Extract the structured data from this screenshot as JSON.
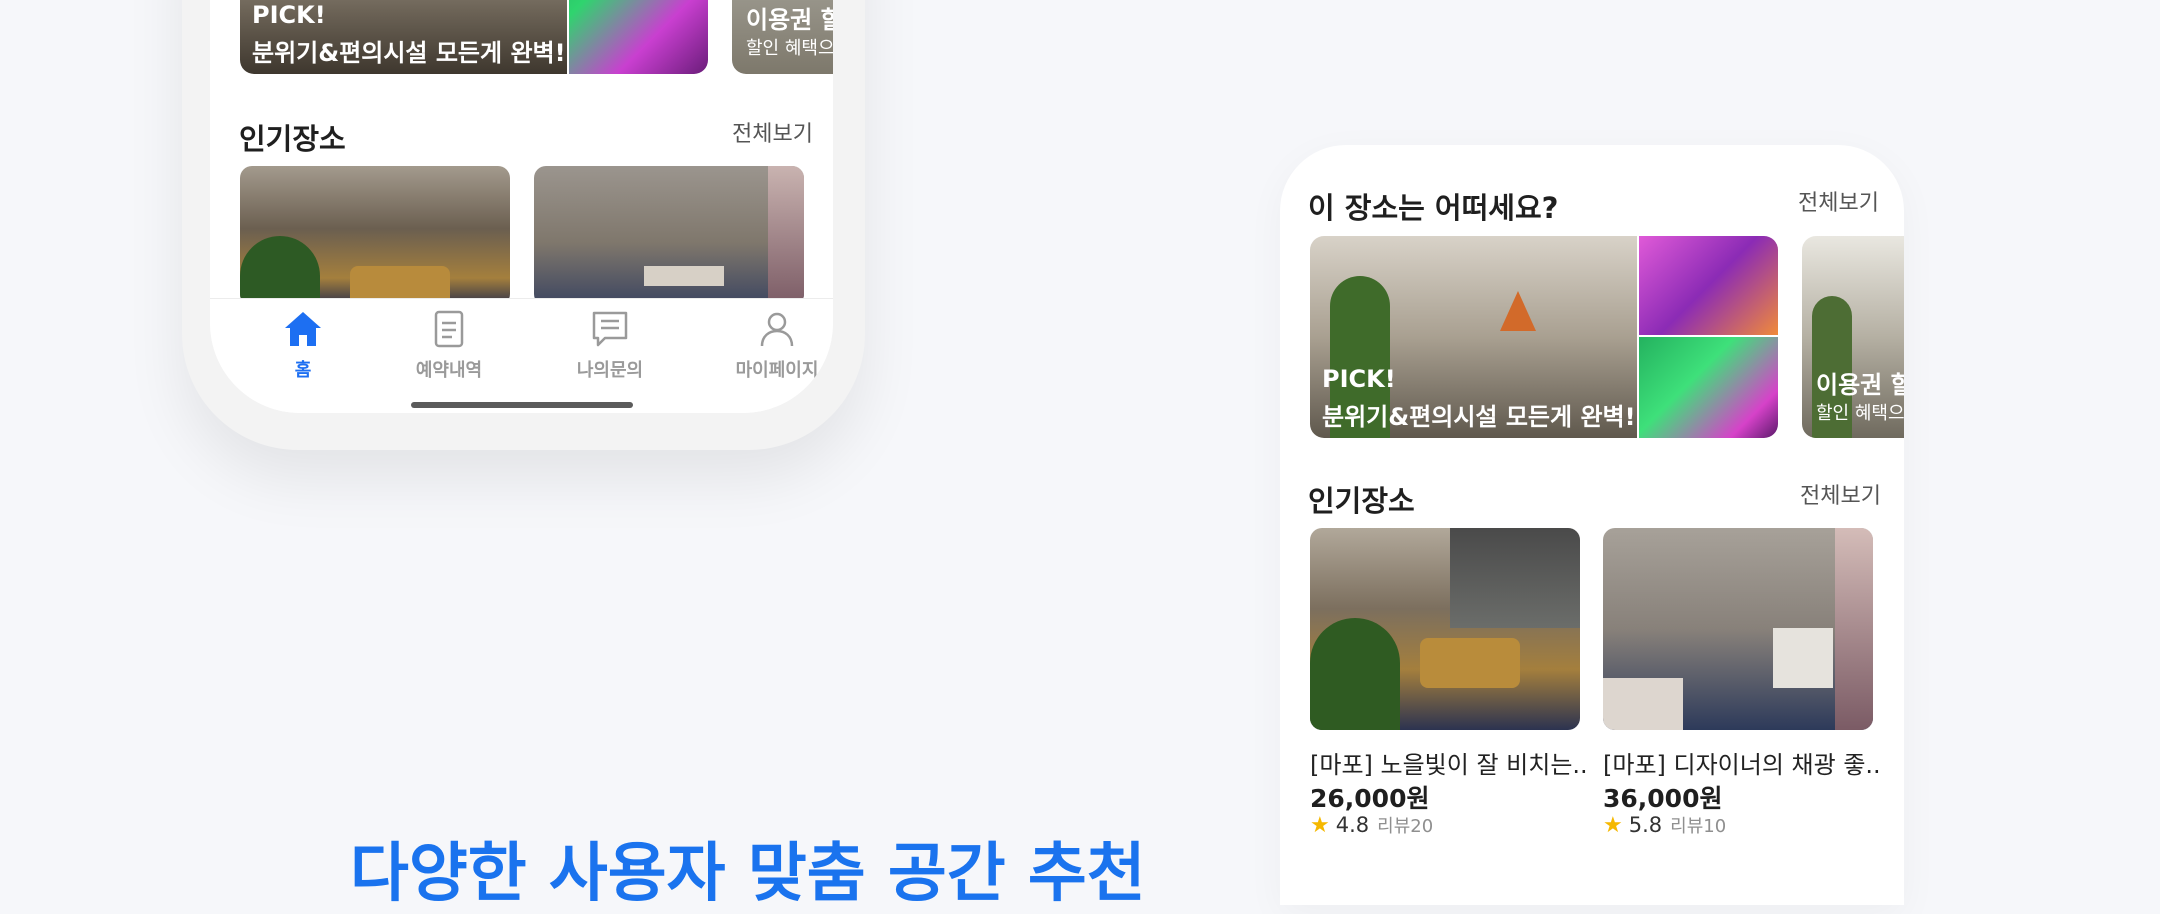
{
  "left_phone": {
    "pick_card": {
      "line1": "PICK!",
      "line2": "분위기&편의시설 모든게 완벽!"
    },
    "voucher_card": {
      "line1": "이용권 할",
      "line2": "할인 혜택으"
    },
    "popular": {
      "title": "인기장소",
      "see_all": "전체보기"
    },
    "tabs": [
      {
        "label": "홈",
        "icon": "home-icon",
        "active": true
      },
      {
        "label": "예약내역",
        "icon": "document-icon",
        "active": false
      },
      {
        "label": "나의문의",
        "icon": "chat-icon",
        "active": false
      },
      {
        "label": "마이페이지",
        "icon": "person-icon",
        "active": false
      }
    ]
  },
  "right_phone": {
    "question": {
      "title": "이 장소는 어떠세요?",
      "see_all": "전체보기"
    },
    "pick_card": {
      "line1": "PICK!",
      "line2": "분위기&편의시설 모든게 완벽!"
    },
    "voucher_card": {
      "line1": "이용권 할",
      "line2": "할인 혜택으"
    },
    "popular": {
      "title": "인기장소",
      "see_all": "전체보기",
      "items": [
        {
          "title": "[마포] 노을빛이 잘 비치는..",
          "price": "26,000원",
          "rating": "4.8",
          "reviews": "리뷰20"
        },
        {
          "title": "[마포] 디자이너의 채광 좋..",
          "price": "36,000원",
          "rating": "5.8",
          "reviews": "리뷰10"
        }
      ]
    }
  },
  "tagline": "다양한 사용자 맞춤 공간 추천",
  "colors": {
    "accent": "#1d6ff2",
    "star": "#f5b800",
    "background": "#f6f7fa"
  }
}
